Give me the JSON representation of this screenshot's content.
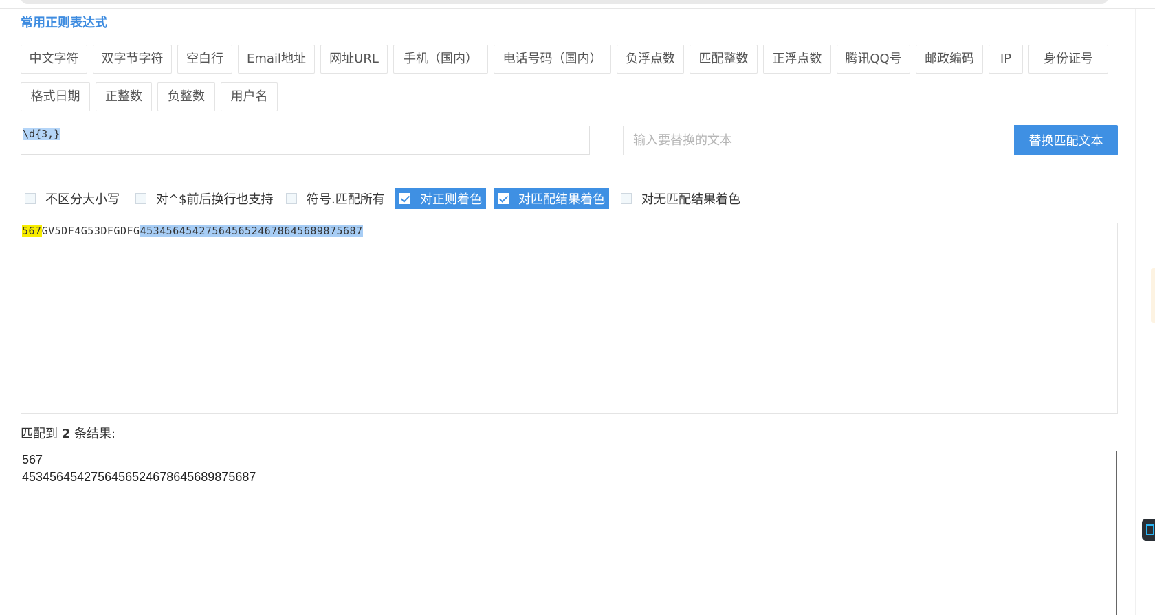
{
  "section_title": "常用正则表达式",
  "presets_row1": [
    "中文字符",
    "双字节字符",
    "空白行",
    "Email地址",
    "网址URL",
    "手机（国内）",
    "电话号码（国内）",
    "负浮点数",
    "匹配整数",
    "正浮点数",
    "腾讯QQ号",
    "邮政编码",
    "IP",
    "身份证号"
  ],
  "presets_row2": [
    "格式日期",
    "正整数",
    "负整数",
    "用户名"
  ],
  "regex": {
    "value": "\\d{3,}"
  },
  "replace": {
    "placeholder": "输入要替换的文本",
    "button_label": "替换匹配文本"
  },
  "options": [
    {
      "label": "不区分大小写",
      "checked": false
    },
    {
      "label": "对^$前后换行也支持",
      "checked": false
    },
    {
      "label": "符号.匹配所有",
      "checked": false
    },
    {
      "label": "对正则着色",
      "checked": true
    },
    {
      "label": "对匹配结果着色",
      "checked": true
    },
    {
      "label": "对无匹配结果着色",
      "checked": false
    }
  ],
  "source_text": {
    "match1": "567",
    "plain": "GV5DF4G53DFGDFG",
    "match2": "453456454275645652467864568987568 7"
  },
  "result": {
    "prefix": "匹配到",
    "count": "2",
    "suffix": "条结果:",
    "lines": [
      "567",
      "453456454275645652467864568987 5687"
    ]
  },
  "colors": {
    "accent": "#3f90e3",
    "match_yellow": "#f7ec00",
    "match_blue": "#a7cdf5"
  }
}
